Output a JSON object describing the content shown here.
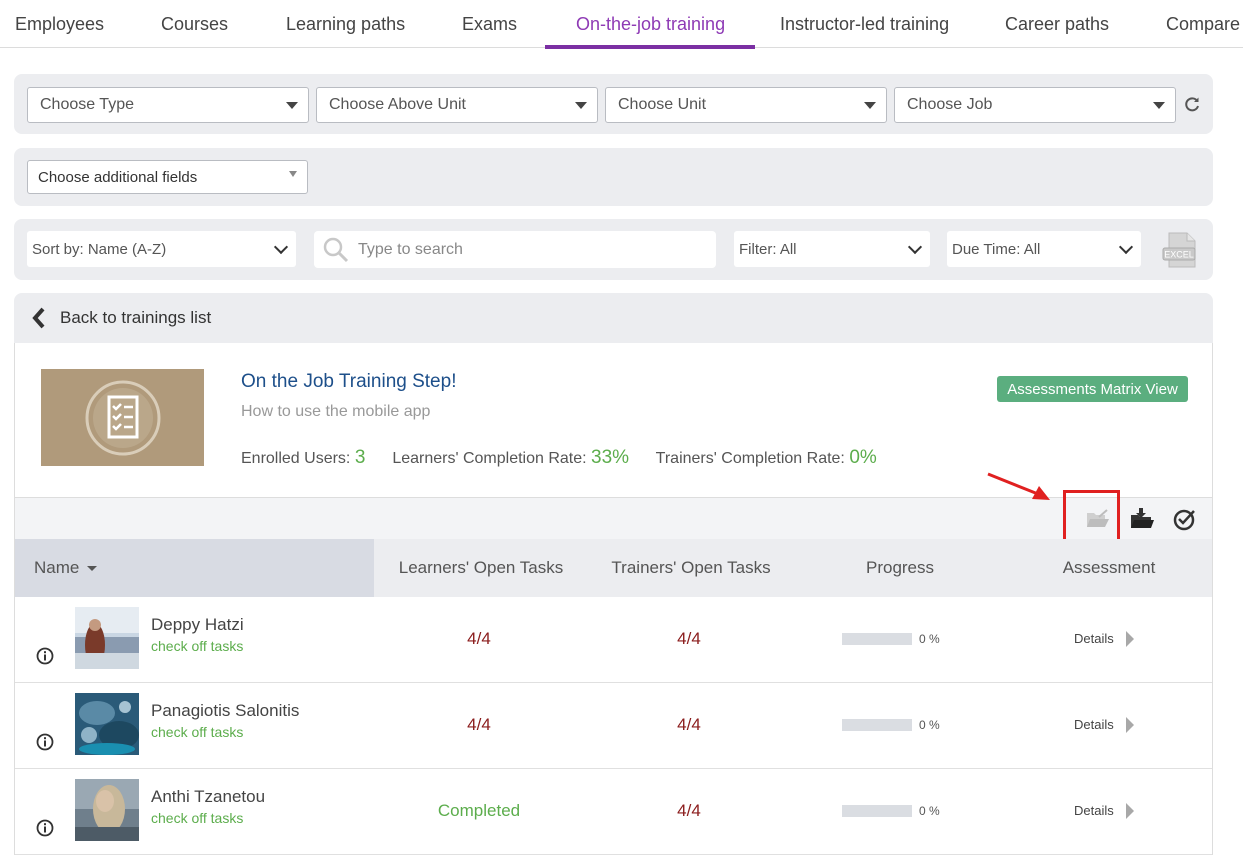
{
  "tabs": [
    {
      "label": "Employees"
    },
    {
      "label": "Courses"
    },
    {
      "label": "Learning paths"
    },
    {
      "label": "Exams"
    },
    {
      "label": "On-the-job training",
      "active": true
    },
    {
      "label": "Instructor-led training"
    },
    {
      "label": "Career paths"
    },
    {
      "label": "Compare"
    }
  ],
  "filters": {
    "type": "Choose Type",
    "above_unit": "Choose Above Unit",
    "unit": "Choose Unit",
    "job": "Choose Job",
    "additional_fields": "Choose additional fields"
  },
  "toolbar": {
    "sort": "Sort by: Name (A-Z)",
    "search_placeholder": "Type to search",
    "filter": "Filter: All",
    "due_time": "Due Time: All",
    "excel_icon": "EXCEL"
  },
  "back": {
    "label": "Back to trainings list"
  },
  "training": {
    "title": "On the Job Training Step!",
    "subtitle": "How to use the mobile app",
    "enrolled_label": "Enrolled Users:",
    "enrolled_value": "3",
    "learners_rate_label": "Learners' Completion Rate:",
    "learners_rate_value": "33%",
    "trainers_rate_label": "Trainers' Completion Rate:",
    "trainers_rate_value": "0%",
    "matrix_button": "Assessments Matrix View"
  },
  "columns": {
    "name": "Name",
    "learners_open": "Learners' Open Tasks",
    "trainers_open": "Trainers' Open Tasks",
    "progress": "Progress",
    "assessment": "Assessment"
  },
  "rows": [
    {
      "name": "Deppy Hatzi",
      "action": "check off tasks",
      "learners": "4/4",
      "trainers": "4/4",
      "progress": 0,
      "progress_label": "0 %",
      "details": "Details"
    },
    {
      "name": "Panagiotis Salonitis",
      "action": "check off tasks",
      "learners": "4/4",
      "trainers": "4/4",
      "progress": 0,
      "progress_label": "0 %",
      "details": "Details"
    },
    {
      "name": "Anthi Tzanetou",
      "action": "check off tasks",
      "learners": "Completed",
      "trainers": "4/4",
      "progress": 0,
      "progress_label": "0 %",
      "details": "Details"
    }
  ],
  "colors": {
    "accent": "#7b2fa3",
    "green": "#5cad4c",
    "matrix_button": "#5bae7f",
    "open_tasks": "#8b1c1c",
    "highlight": "#e02020"
  }
}
